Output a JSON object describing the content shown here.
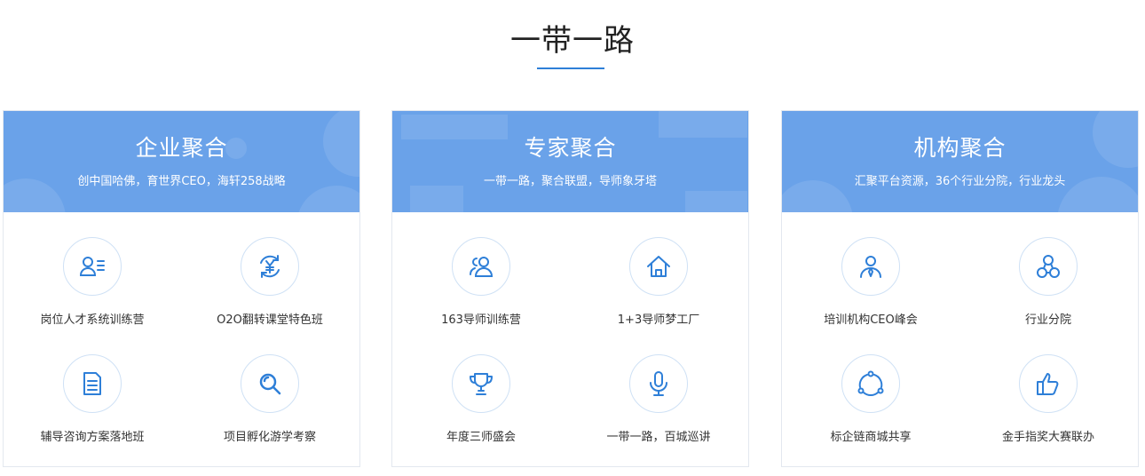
{
  "page": {
    "title": "一带一路",
    "accent_color": "#2e7fd8",
    "header_color": "#6aa2e9"
  },
  "cards": [
    {
      "title": "企业聚合",
      "subtitle": "创中国哈佛，育世界CEO，海轩258战略",
      "items": [
        {
          "label": "岗位人才系统训练营",
          "icon": "person-card-icon"
        },
        {
          "label": "O2O翻转课堂特色班",
          "icon": "yuan-cycle-icon"
        },
        {
          "label": "辅导咨询方案落地班",
          "icon": "document-icon"
        },
        {
          "label": "项目孵化游学考察",
          "icon": "search-icon"
        }
      ]
    },
    {
      "title": "专家聚合",
      "subtitle": "一带一路，聚合联盟，导师象牙塔",
      "items": [
        {
          "label": "163导师训练营",
          "icon": "group-icon"
        },
        {
          "label": "1+3导师梦工厂",
          "icon": "home-icon"
        },
        {
          "label": "年度三师盛会",
          "icon": "trophy-icon"
        },
        {
          "label": "一带一路，百城巡讲",
          "icon": "microphone-icon"
        }
      ]
    },
    {
      "title": "机构聚合",
      "subtitle": "汇聚平台资源，36个行业分院，行业龙头",
      "items": [
        {
          "label": "培训机构CEO峰会",
          "icon": "business-person-icon"
        },
        {
          "label": "行业分院",
          "icon": "network-icon"
        },
        {
          "label": "标企链商城共享",
          "icon": "share-cycle-icon"
        },
        {
          "label": "金手指奖大赛联办",
          "icon": "thumbs-up-icon"
        }
      ]
    }
  ]
}
